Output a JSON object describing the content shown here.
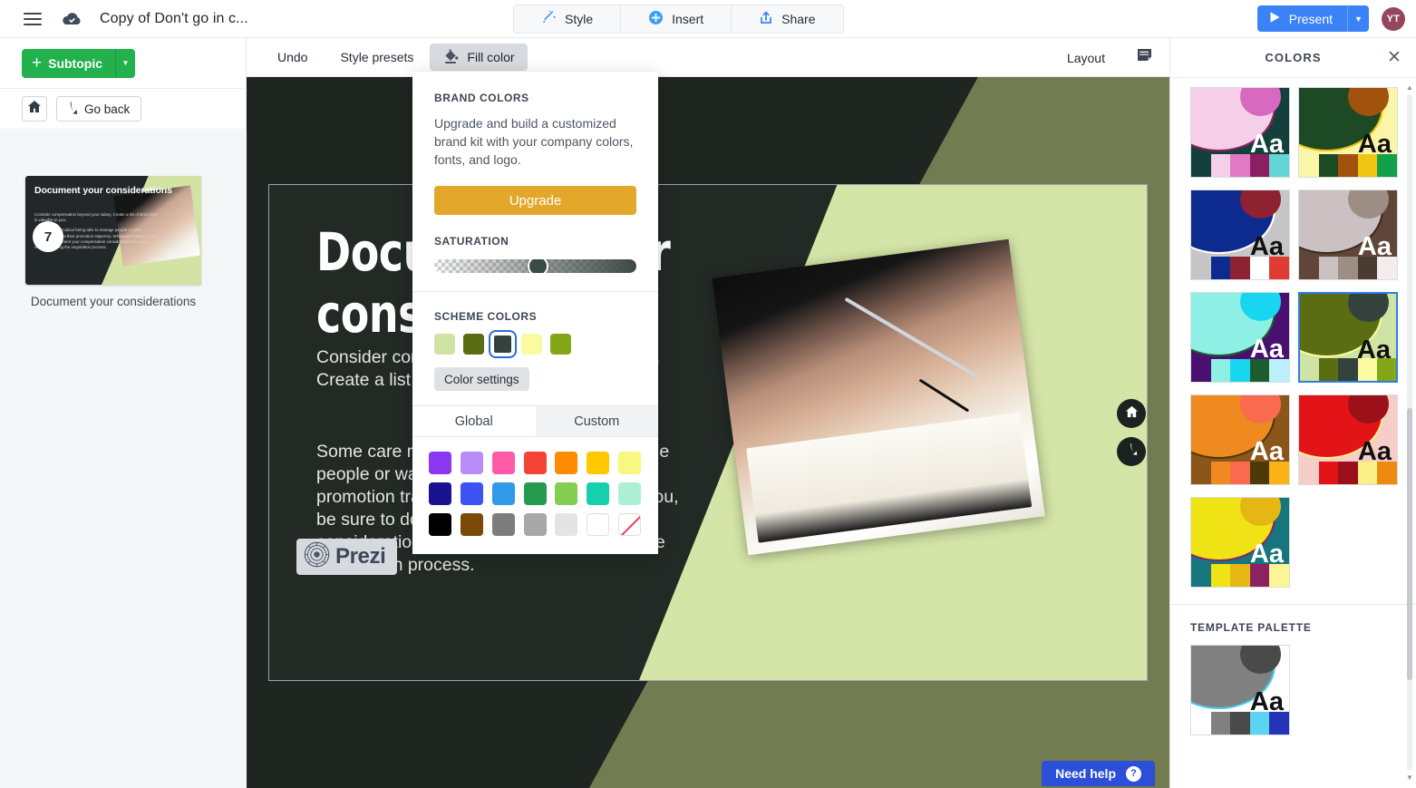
{
  "topbar": {
    "menu_icon": "hamburger-icon",
    "cloud_icon": "cloud-saved-icon",
    "doc_title": "Copy of Don't go in c...",
    "tools": [
      {
        "label": "Style",
        "icon": "magic-wand-icon"
      },
      {
        "label": "Insert",
        "icon": "plus-circle-icon"
      },
      {
        "label": "Share",
        "icon": "share-upload-icon"
      }
    ],
    "present_label": "Present",
    "present_icon": "play-icon",
    "present_caret": "▼",
    "avatar_initials": "YT",
    "accent_blue": "#3b82f6",
    "avatar_color": "#94475c"
  },
  "left_panel": {
    "subtopic_label": "Subtopic",
    "subtopic_plus": "+",
    "subtopic_caret": "▼",
    "subtopic_color": "#22b14c",
    "home_icon": "home-icon",
    "go_back_label": "Go back",
    "go_back_icon": "back-arrow-icon",
    "thumbnail": {
      "number": "7",
      "title": "Document your considerations",
      "body_1": "Consider compensation beyond your salary. Create a list of items that is valuable to you.",
      "body_2": "Some care most about being able to manage people or want assurances about their promotion trajectory. Whatever matters to you, be sure to document your compensation considerations for quick reference during the negotiation process.",
      "caption": "Document your considerations"
    }
  },
  "subtoolbar": {
    "undo_label": "Undo",
    "style_presets_label": "Style presets",
    "fill_color_label": "Fill color",
    "fill_color_icon": "paint-bucket-icon",
    "layout_label": "Layout",
    "notes_icon": "speaker-notes-icon"
  },
  "slide": {
    "heading": "Document your considerations",
    "paragraph_1": "Consider compensation beyond your salary. Create a list of items that is valuable to you.",
    "paragraph_2": "Some care most about being able to manage people or want assurances about their promotion trajectory. Whatever matters to you, be sure to document your compensation considerations for quick reference during the negotiation process.",
    "prezi_logo_text": "Prezi",
    "prezi_logo_icon": "prezi-mark-icon",
    "nav_home_icon": "home-icon",
    "nav_back_icon": "back-arrow-icon",
    "need_help_label": "Need help",
    "need_help_icon": "question-mark-icon",
    "need_help_color": "#2b4fd8",
    "background_dark": "#232a26",
    "background_olive": "#737b50",
    "accent_green": "#d4e5a7"
  },
  "fill_popover": {
    "brand_colors_label": "BRAND COLORS",
    "brand_colors_desc": "Upgrade and build a customized brand kit with your company colors, fonts, and logo.",
    "upgrade_label": "Upgrade",
    "upgrade_color": "#e3a82b",
    "saturation_label": "SATURATION",
    "saturation_value": 48,
    "scheme_colors_label": "SCHEME COLORS",
    "scheme_swatches": [
      {
        "hex": "#cfe3a4",
        "selected": false
      },
      {
        "hex": "#5b6d13",
        "selected": false
      },
      {
        "hex": "#33423d",
        "selected": true
      },
      {
        "hex": "#fafaa0",
        "selected": false
      },
      {
        "hex": "#82a817",
        "selected": false
      }
    ],
    "color_settings_label": "Color settings",
    "tabs": [
      {
        "label": "Global",
        "active": true
      },
      {
        "label": "Custom",
        "active": false
      }
    ],
    "palette_grid": [
      {
        "hex": "#8b36f0",
        "kind": "solid"
      },
      {
        "hex": "#b98cf7",
        "kind": "solid"
      },
      {
        "hex": "#ff5aa8",
        "kind": "solid"
      },
      {
        "hex": "#f44336",
        "kind": "solid"
      },
      {
        "hex": "#ff8c00",
        "kind": "solid"
      },
      {
        "hex": "#ffc800",
        "kind": "solid"
      },
      {
        "hex": "#f9f87e",
        "kind": "solid"
      },
      {
        "hex": "#1a128e",
        "kind": "solid"
      },
      {
        "hex": "#3d51f5",
        "kind": "solid"
      },
      {
        "hex": "#2f9ae8",
        "kind": "solid"
      },
      {
        "hex": "#259c4d",
        "kind": "solid"
      },
      {
        "hex": "#84ce53",
        "kind": "solid"
      },
      {
        "hex": "#15cfae",
        "kind": "solid"
      },
      {
        "hex": "#abf0d5",
        "kind": "solid"
      },
      {
        "hex": "#000000",
        "kind": "solid"
      },
      {
        "hex": "#7a4a06",
        "kind": "solid"
      },
      {
        "hex": "#7d7d7d",
        "kind": "solid"
      },
      {
        "hex": "#a8a8a8",
        "kind": "solid"
      },
      {
        "hex": "#e4e4e4",
        "kind": "solid"
      },
      {
        "hex": "#ffffff",
        "kind": "outline"
      },
      {
        "hex": "#ffffff",
        "kind": "none"
      }
    ]
  },
  "colors_panel": {
    "title": "COLORS",
    "close_icon": "close-icon",
    "template_palette_label": "TEMPLATE PALETTE",
    "aa_text": "Aa",
    "scroll_up_icon": "chevron-up-icon",
    "scroll_down_icon": "chevron-down-icon",
    "palettes": [
      {
        "name": "pink-teal",
        "bg": "#14403c",
        "big": "#f4cfe7",
        "ring": "#8c1f60",
        "small": "#d868c0",
        "aa": "#ffffff",
        "strip": [
          "#14403c",
          "#f4cfe7",
          "#e07ac4",
          "#8c1f60",
          "#62d6d6"
        ],
        "selected": false
      },
      {
        "name": "green-yellow",
        "bg": "#fbf5a8",
        "big": "#1d4a24",
        "ring": "#f2c513",
        "small": "#a1520d",
        "aa": "#111111",
        "strip": [
          "#fbf5a8",
          "#1d4a24",
          "#a1520d",
          "#f2c513",
          "#13a04b"
        ],
        "selected": false
      },
      {
        "name": "blue-grey",
        "bg": "#c6c6c6",
        "big": "#0d2a8e",
        "ring": "#ffffff",
        "small": "#8e2230",
        "aa": "#111111",
        "strip": [
          "#c6c6c6",
          "#0d2a8e",
          "#8e2230",
          "#ffffff",
          "#e03c33"
        ],
        "selected": false
      },
      {
        "name": "brown-mauve",
        "bg": "#5f4638",
        "big": "#cbc0c2",
        "ring": "#3b2b22",
        "small": "#9c8d85",
        "aa": "#ffffff",
        "strip": [
          "#5f4638",
          "#cbc0c2",
          "#9c8d85",
          "#4a3b33",
          "#f2eceb"
        ],
        "selected": false
      },
      {
        "name": "purple-cyan",
        "bg": "#4a1070",
        "big": "#8ef0e4",
        "ring": "#1d5c2c",
        "small": "#19d6f0",
        "aa": "#ffffff",
        "strip": [
          "#4a1070",
          "#8ef0e4",
          "#19d6f0",
          "#1d5c2c",
          "#bdeefb"
        ],
        "selected": false
      },
      {
        "name": "olive-green",
        "bg": "#cfe3a4",
        "big": "#5b6d13",
        "ring": "#fafaa0",
        "small": "#33423d",
        "aa": "#111111",
        "strip": [
          "#cfe3a4",
          "#5b6d13",
          "#33423d",
          "#fafaa0",
          "#82a817"
        ],
        "selected": true
      },
      {
        "name": "orange-brown",
        "bg": "#8c561a",
        "big": "#ef8a21",
        "ring": "#4b3a07",
        "small": "#f96a4e",
        "aa": "#ffffff",
        "strip": [
          "#8c561a",
          "#ef8a21",
          "#f96a4e",
          "#4b3a07",
          "#fcb316"
        ],
        "selected": false
      },
      {
        "name": "red-pink",
        "bg": "#f7cdc8",
        "big": "#e21417",
        "ring": "#fbef8a",
        "small": "#9c1119",
        "aa": "#111111",
        "strip": [
          "#f7cdc8",
          "#e21417",
          "#9c1119",
          "#fbef8a",
          "#ef8a10"
        ],
        "selected": false
      },
      {
        "name": "yellow-teal",
        "bg": "#16757d",
        "big": "#f0e315",
        "ring": "#8c2360",
        "small": "#e5b614",
        "aa": "#ffffff",
        "strip": [
          "#16757d",
          "#f0e315",
          "#e5b614",
          "#8c2360",
          "#fbf593"
        ],
        "selected": false
      }
    ],
    "template_palette": {
      "name": "grey-cyan",
      "bg": "#ffffff",
      "big": "#808080",
      "ring": "#42cdec",
      "small": "#4a4a4a",
      "aa": "#111111",
      "strip": [
        "#ffffff",
        "#808080",
        "#4a4a4a",
        "#5ad4f0",
        "#2433b8"
      ]
    }
  }
}
